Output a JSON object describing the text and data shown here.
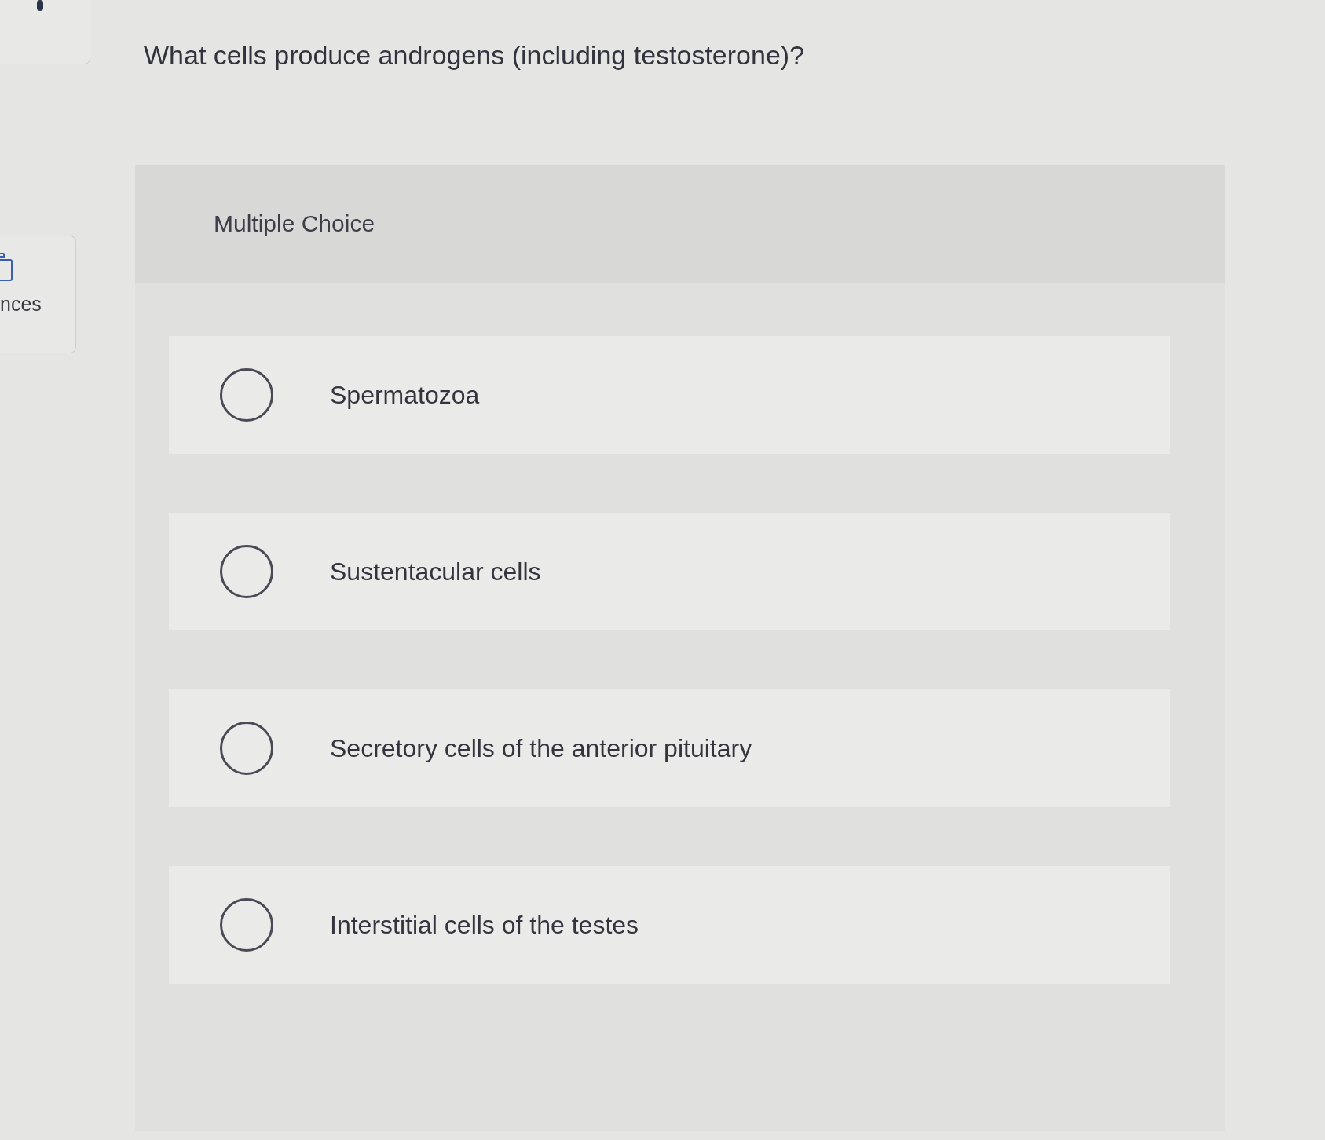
{
  "sidebar": {
    "items": [
      {
        "label": "nces"
      }
    ]
  },
  "question": {
    "text": "What cells produce androgens (including testosterone)?"
  },
  "answer_panel": {
    "heading": "Multiple Choice",
    "options": [
      {
        "label": "Spermatozoa",
        "selected": false
      },
      {
        "label": "Sustentacular cells",
        "selected": false
      },
      {
        "label": "Secretory cells of the anterior pituitary",
        "selected": false
      },
      {
        "label": "Interstitial cells of the testes",
        "selected": false
      }
    ]
  }
}
